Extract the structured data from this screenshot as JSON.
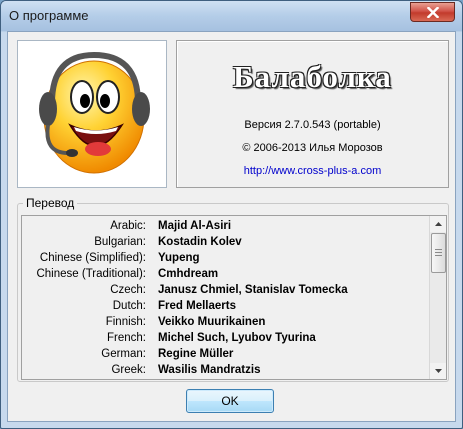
{
  "window": {
    "title": "О программе",
    "close_icon": "close-icon"
  },
  "about": {
    "logo_icon": "smiley-headset-icon",
    "app_name": "Балаболка",
    "version": "Версия 2.7.0.543 (portable)",
    "copyright": "© 2006-2013 Илья Морозов",
    "website": "http://www.cross-plus-a.com"
  },
  "translation": {
    "group_label": "Перевод",
    "rows": [
      {
        "language": "Arabic:",
        "translator": "Majid Al-Asiri"
      },
      {
        "language": "Bulgarian:",
        "translator": "Kostadin Kolev"
      },
      {
        "language": "Chinese (Simplified):",
        "translator": "Yupeng"
      },
      {
        "language": "Chinese (Traditional):",
        "translator": "Cmhdream"
      },
      {
        "language": "Czech:",
        "translator": "Janusz Chmiel, Stanislav Tomecka"
      },
      {
        "language": "Dutch:",
        "translator": "Fred Mellaerts"
      },
      {
        "language": "Finnish:",
        "translator": "Veikko Muurikainen"
      },
      {
        "language": "French:",
        "translator": "Michel Such, Lyubov Tyurina"
      },
      {
        "language": "German:",
        "translator": "Regine Müller"
      },
      {
        "language": "Greek:",
        "translator": "Wasilis Mandratzis"
      }
    ],
    "scroll_position": 0.0
  },
  "buttons": {
    "ok_label": "OK"
  },
  "colors": {
    "link": "#0000cc",
    "close_button": "#c9463a",
    "ok_border": "#3c7fb1"
  }
}
